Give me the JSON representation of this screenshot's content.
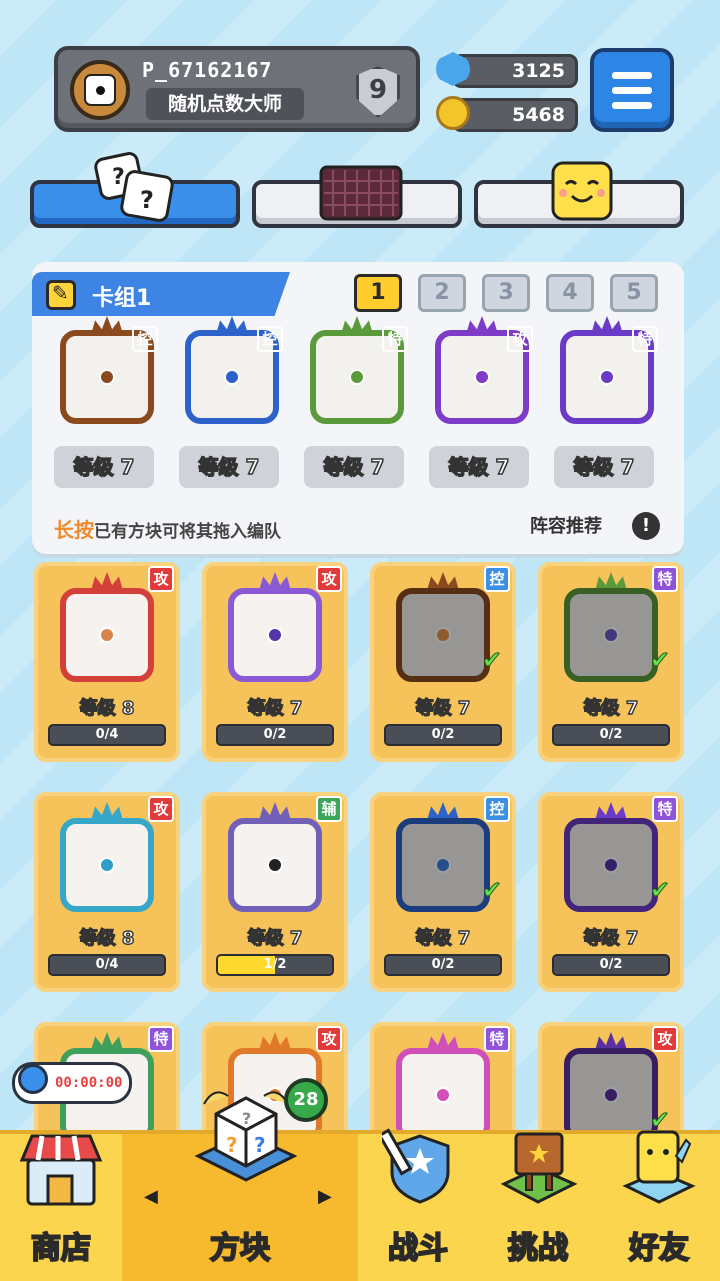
{
  "player": {
    "name": "P_67162167",
    "title": "随机点数大师",
    "rank": "9"
  },
  "resources": {
    "gems": "3125",
    "coins": "5468"
  },
  "category_tabs": [
    {
      "name": "dice",
      "active": true
    },
    {
      "name": "board",
      "active": false
    },
    {
      "name": "emoji",
      "active": false
    }
  ],
  "deck": {
    "name": "卡组1",
    "tabs": [
      "1",
      "2",
      "3",
      "4",
      "5"
    ],
    "active_tab": "1",
    "slots": [
      {
        "tag": "控",
        "level": "等级 7",
        "color": "#8a4a1e"
      },
      {
        "tag": "控",
        "level": "等级 7",
        "color": "#2c62c9"
      },
      {
        "tag": "特",
        "level": "等级 7",
        "color": "#5a9a3a"
      },
      {
        "tag": "攻",
        "level": "等级 7",
        "color": "#7e3bc6"
      },
      {
        "tag": "特",
        "level": "等级 7",
        "color": "#6a3bc6"
      }
    ],
    "hint_highlight": "长按",
    "hint_text": "已有方块可将其拖入编队",
    "recommend": "阵容推荐",
    "info_icon": "!"
  },
  "cards": [
    {
      "tag": "攻",
      "level": "等级 8",
      "progress": "0/4",
      "progress_value": 0,
      "color": "#d3403a",
      "dot": "#d9844d",
      "owned": false
    },
    {
      "tag": "攻",
      "level": "等级 7",
      "progress": "0/2",
      "progress_value": 0,
      "color": "#8a5ad6",
      "dot": "#5533a8",
      "owned": false
    },
    {
      "tag": "控",
      "level": "等级 7",
      "progress": "0/2",
      "progress_value": 0,
      "color": "#8a4a1e",
      "dot": "#e4914a",
      "owned": true
    },
    {
      "tag": "特",
      "level": "等级 7",
      "progress": "0/2",
      "progress_value": 0,
      "color": "#5a9a3a",
      "dot": "#6b58c8",
      "owned": true
    },
    {
      "tag": "攻",
      "level": "等级 8",
      "progress": "0/4",
      "progress_value": 0,
      "color": "#36a6c9",
      "dot": "#2ea0c8",
      "owned": false
    },
    {
      "tag": "辅",
      "level": "等级 7",
      "progress": "1/2",
      "progress_value": 0.5,
      "color": "#7060b8",
      "dot": "#222222",
      "owned": false
    },
    {
      "tag": "控",
      "level": "等级 7",
      "progress": "0/2",
      "progress_value": 0,
      "color": "#2c62c9",
      "dot": "#3b7fe0",
      "owned": true
    },
    {
      "tag": "特",
      "level": "等级 7",
      "progress": "0/2",
      "progress_value": 0,
      "color": "#6a3bc6",
      "dot": "#5533a8",
      "owned": true
    },
    {
      "tag": "特",
      "level": "",
      "progress": "",
      "progress_value": 0,
      "color": "#3ea05a",
      "dot": "#3ea05a",
      "owned": false
    },
    {
      "tag": "攻",
      "level": "",
      "progress": "",
      "progress_value": 0,
      "color": "#e07a2a",
      "dot": "#e07a2a",
      "owned": false
    },
    {
      "tag": "特",
      "level": "",
      "progress": "",
      "progress_value": 0,
      "color": "#d04fb8",
      "dot": "#d04fb8",
      "owned": false
    },
    {
      "tag": "攻",
      "level": "",
      "progress": "",
      "progress_value": 0,
      "color": "#5a2fa0",
      "dot": "#5a2fa0",
      "owned": true
    }
  ],
  "timer": "00:00:00",
  "nav": {
    "shop": "商店",
    "blocks": "方块",
    "battle": "战斗",
    "challenge": "挑战",
    "friends": "好友",
    "blocks_badge": "28",
    "arrow_left": "◀",
    "arrow_right": "▶"
  }
}
